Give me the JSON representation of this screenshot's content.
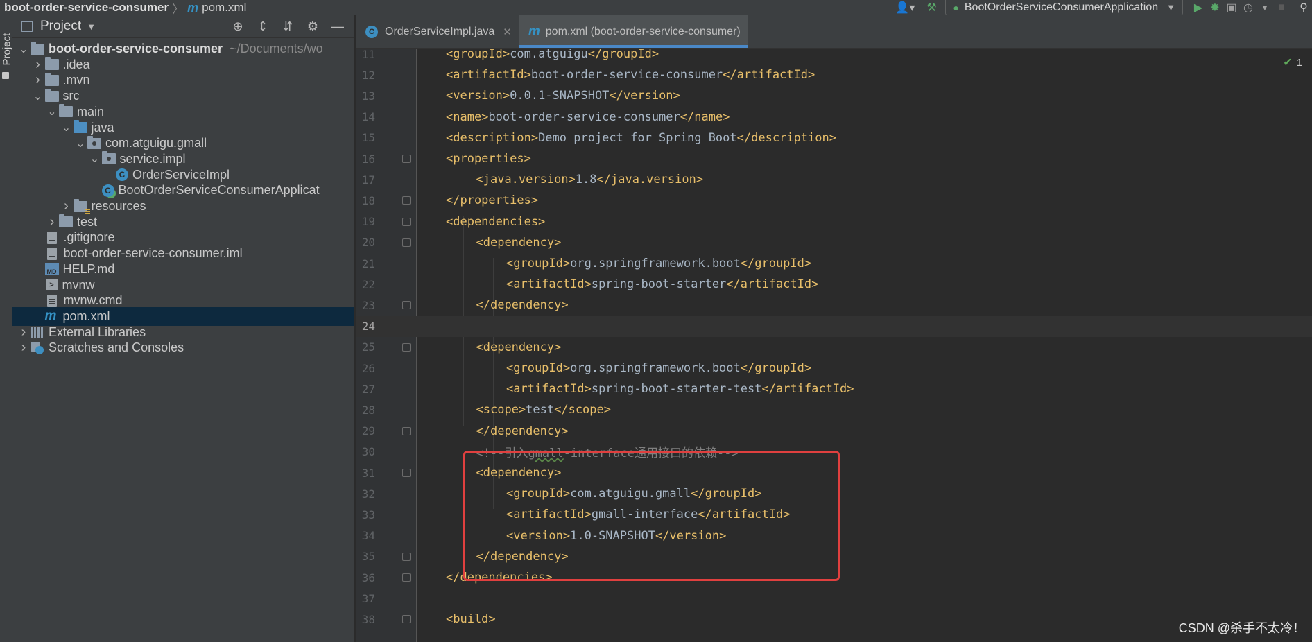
{
  "breadcrumb": {
    "project": "boot-order-service-consumer",
    "separator": "〉",
    "file_icon": "m",
    "file": "pom.xml"
  },
  "toolbar": {
    "run_config": "BootOrderServiceConsumerApplication"
  },
  "left_strip": {
    "label": "Project"
  },
  "project_panel": {
    "title": "Project",
    "tree": [
      {
        "label": "boot-order-service-consumer",
        "path": "~/Documents/wo",
        "icon": "module-folder-icon",
        "arrow": "expanded",
        "bold": true
      },
      {
        "label": ".idea",
        "icon": "folder-icon",
        "arrow": "collapsed"
      },
      {
        "label": ".mvn",
        "icon": "folder-icon",
        "arrow": "collapsed"
      },
      {
        "label": "src",
        "icon": "folder-icon",
        "arrow": "expanded"
      },
      {
        "label": "main",
        "icon": "folder-icon",
        "arrow": "expanded"
      },
      {
        "label": "java",
        "icon": "source-folder-icon",
        "arrow": "expanded"
      },
      {
        "label": "com.atguigu.gmall",
        "icon": "package-icon",
        "arrow": "expanded"
      },
      {
        "label": "service.impl",
        "icon": "package-icon",
        "arrow": "expanded"
      },
      {
        "label": "OrderServiceImpl",
        "icon": "class-icon",
        "arrow": "none"
      },
      {
        "label": "BootOrderServiceConsumerApplicat",
        "icon": "spring-boot-class-icon",
        "arrow": "none"
      },
      {
        "label": "resources",
        "icon": "resources-folder-icon",
        "arrow": "collapsed"
      },
      {
        "label": "test",
        "icon": "folder-icon",
        "arrow": "collapsed"
      },
      {
        "label": ".gitignore",
        "icon": "gitignore-file-icon",
        "arrow": "none"
      },
      {
        "label": "boot-order-service-consumer.iml",
        "icon": "iml-file-icon",
        "arrow": "none"
      },
      {
        "label": "HELP.md",
        "icon": "markdown-file-icon",
        "arrow": "none"
      },
      {
        "label": "mvnw",
        "icon": "shell-script-icon",
        "arrow": "none"
      },
      {
        "label": "mvnw.cmd",
        "icon": "text-file-icon",
        "arrow": "none"
      },
      {
        "label": "pom.xml",
        "icon": "maven-file-icon",
        "arrow": "none",
        "selected": true
      },
      {
        "label": "External Libraries",
        "icon": "libraries-icon",
        "arrow": "collapsed"
      },
      {
        "label": "Scratches and Consoles",
        "icon": "scratches-icon",
        "arrow": "collapsed"
      }
    ]
  },
  "tabs": [
    {
      "label": "OrderServiceImpl.java",
      "icon": "class-icon",
      "active": false,
      "close": "✕"
    },
    {
      "label": "pom.xml (boot-order-service-consumer)",
      "icon": "maven-file-icon",
      "active": true,
      "close": ""
    }
  ],
  "editor": {
    "inspections": {
      "count": "1"
    },
    "lines": [
      {
        "n": "11",
        "code": "<groupId>com.atguigu</groupId>"
      },
      {
        "n": "12",
        "code": "<artifactId>boot-order-service-consumer</artifactId>"
      },
      {
        "n": "13",
        "code": "<version>0.0.1-SNAPSHOT</version>"
      },
      {
        "n": "14",
        "code": "<name>boot-order-service-consumer</name>"
      },
      {
        "n": "15",
        "code": "<description>Demo project for Spring Boot</description>"
      },
      {
        "n": "16",
        "code": "<properties>"
      },
      {
        "n": "17",
        "code": "<java.version>1.8</java.version>"
      },
      {
        "n": "18",
        "code": "</properties>"
      },
      {
        "n": "19",
        "code": "<dependencies>"
      },
      {
        "n": "20",
        "code": "<dependency>"
      },
      {
        "n": "21",
        "code": "<groupId>org.springframework.boot</groupId>"
      },
      {
        "n": "22",
        "code": "<artifactId>spring-boot-starter</artifactId>"
      },
      {
        "n": "23",
        "code": "</dependency>"
      },
      {
        "n": "24",
        "code": ""
      },
      {
        "n": "25",
        "code": "<dependency>"
      },
      {
        "n": "26",
        "code": "<groupId>org.springframework.boot</groupId>"
      },
      {
        "n": "27",
        "code": "<artifactId>spring-boot-starter-test</artifactId>"
      },
      {
        "n": "28",
        "code": "<scope>test</scope>"
      },
      {
        "n": "29",
        "code": "</dependency>"
      },
      {
        "n": "30",
        "code": "<!--引入gmall-interface通用接口的依赖-->"
      },
      {
        "n": "31",
        "code": "<dependency>"
      },
      {
        "n": "32",
        "code": "<groupId>com.atguigu.gmall</groupId>"
      },
      {
        "n": "33",
        "code": "<artifactId>gmall-interface</artifactId>"
      },
      {
        "n": "34",
        "code": "<version>1.0-SNAPSHOT</version>"
      },
      {
        "n": "35",
        "code": "</dependency>"
      },
      {
        "n": "36",
        "code": "</dependencies>"
      },
      {
        "n": "37",
        "code": ""
      },
      {
        "n": "38",
        "code": "<build>"
      }
    ]
  },
  "watermark": "CSDN @杀手不太冷！",
  "colors": {
    "tag": "#e8bf6a",
    "text": "#a9b7c6",
    "comment": "#808080",
    "highlight": "#e0403f",
    "selection": "#0d293e",
    "accent": "#4a88c7"
  }
}
